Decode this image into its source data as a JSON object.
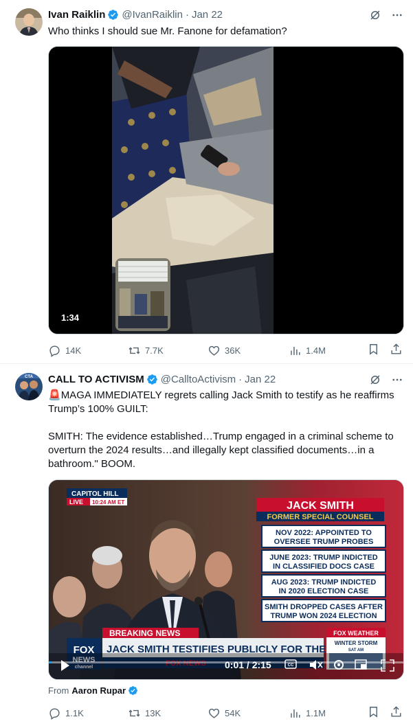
{
  "tweet1": {
    "name": "Ivan Raiklin",
    "handle": "@IvanRaiklin",
    "separator": "·",
    "date": "Jan 22",
    "text": "Who thinks I should sue Mr. Fanone for defamation?",
    "video_time": "1:34",
    "replies": "14K",
    "reposts": "7.7K",
    "likes": "36K",
    "views": "1.4M"
  },
  "tweet2": {
    "name": "CALL TO ACTIVISM",
    "handle": "@CalltoActivism",
    "separator": "·",
    "date": "Jan 22",
    "text_line1_icon": "🚨",
    "text_p1": "MAGA IMMEDIATELY regrets calling Jack Smith to testify as he reaffirms Trump’s 100% GUILT:",
    "text_p2": "SMITH: The evidence established…Trump engaged in a criminal scheme to overturn the 2024 results…and illegally kept classified documents…in a bathroom.\" BOOM.",
    "video": {
      "location": "CAPITOL HILL",
      "live": "LIVE",
      "live_time": "10:24 AM ET",
      "name_banner": "JACK SMITH",
      "title_banner": "FORMER SPECIAL COUNSEL",
      "facts": [
        "NOV 2022: APPOINTED TO OVERSEE TRUMP PROBES",
        "JUNE 2023: TRUMP INDICTED IN CLASSIFIED DOCS CASE",
        "AUG 2023: TRUMP INDICTED IN 2020 ELECTION CASE",
        "SMITH DROPPED CASES AFTER TRUMP WON 2024 ELECTION"
      ],
      "breaking": "BREAKING NEWS",
      "headline": "JACK SMITH TESTIFIES PUBLICLY FOR THE FIRST TIME",
      "network": "FOX NEWS",
      "network_sub": "channel",
      "weather_brand": "FOX WEATHER",
      "weather_text": "WINTER STORM",
      "weather_time": "SAT AM",
      "time_display": "0:01 / 2:15",
      "progress": 0.0074
    },
    "from_label": "From",
    "from_name": "Aaron Rupar",
    "replies": "1.1K",
    "reposts": "13K",
    "likes": "54K",
    "views": "1.1M"
  },
  "colors": {
    "verified": "#1d9bf0",
    "fox_red": "#c8102e",
    "fox_navy": "#0b2d5c",
    "muted": "#536471"
  }
}
